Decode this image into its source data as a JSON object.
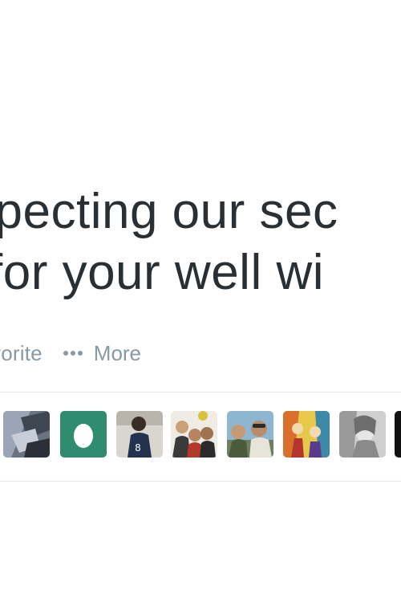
{
  "tweet": {
    "text_line_1": "xpecting our sec",
    "text_line_2": "for your well wi"
  },
  "actions": {
    "favorite_label": "vorite",
    "more_label": "More"
  },
  "colors": {
    "text": "#292f33",
    "muted": "#8899a6",
    "divider": "#e1e8ed",
    "egg_avatar_bg": "#2f8c6e"
  },
  "favorited_by": {
    "avatars": [
      {
        "name": "avatar-user-1"
      },
      {
        "name": "avatar-default-egg"
      },
      {
        "name": "avatar-user-3"
      },
      {
        "name": "avatar-user-4"
      },
      {
        "name": "avatar-user-5"
      },
      {
        "name": "avatar-user-6"
      },
      {
        "name": "avatar-user-7"
      },
      {
        "name": "avatar-user-8"
      }
    ]
  }
}
